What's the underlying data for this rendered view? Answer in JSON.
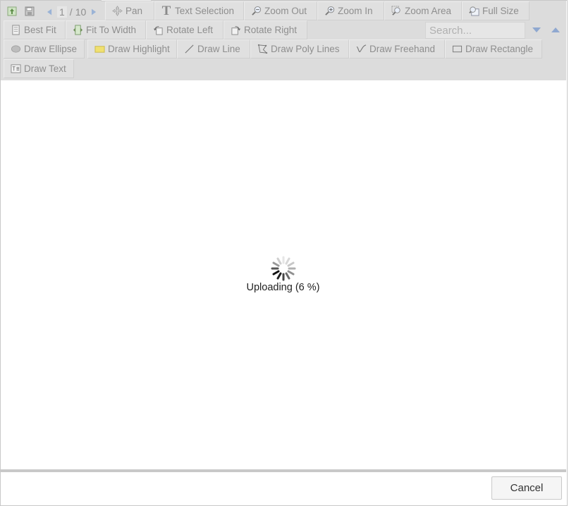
{
  "toolbar": {
    "pager": {
      "current": "1",
      "separator": "/",
      "total": "10"
    },
    "row1": [
      {
        "name": "pan-button",
        "icon": "pan-icon",
        "label": "Pan"
      },
      {
        "name": "text-selection-button",
        "icon": "text-selection-icon",
        "label": "Text Selection"
      },
      {
        "name": "zoom-out-button",
        "icon": "zoom-out-icon",
        "label": "Zoom Out"
      },
      {
        "name": "zoom-in-button",
        "icon": "zoom-in-icon",
        "label": "Zoom In"
      },
      {
        "name": "zoom-area-button",
        "icon": "zoom-area-icon",
        "label": "Zoom Area"
      },
      {
        "name": "full-size-button",
        "icon": "full-size-icon",
        "label": "Full Size"
      }
    ],
    "row2": [
      {
        "name": "best-fit-button",
        "icon": "best-fit-icon",
        "label": "Best Fit"
      },
      {
        "name": "fit-to-width-button",
        "icon": "fit-to-width-icon",
        "label": "Fit To Width"
      },
      {
        "name": "rotate-left-button",
        "icon": "rotate-left-icon",
        "label": "Rotate Left"
      },
      {
        "name": "rotate-right-button",
        "icon": "rotate-right-icon",
        "label": "Rotate Right"
      }
    ],
    "row3": [
      {
        "name": "draw-ellipse-button",
        "icon": "ellipse-icon",
        "label": "Draw Ellipse"
      },
      {
        "name": "draw-highlight-button",
        "icon": "highlight-icon",
        "label": "Draw Highlight"
      },
      {
        "name": "draw-line-button",
        "icon": "line-icon",
        "label": "Draw Line"
      },
      {
        "name": "draw-poly-lines-button",
        "icon": "poly-lines-icon",
        "label": "Draw Poly Lines"
      },
      {
        "name": "draw-freehand-button",
        "icon": "freehand-icon",
        "label": "Draw Freehand"
      },
      {
        "name": "draw-rectangle-button",
        "icon": "rectangle-icon",
        "label": "Draw Rectangle"
      }
    ],
    "row4": [
      {
        "name": "draw-text-button",
        "icon": "draw-text-icon",
        "label": "Draw Text"
      }
    ],
    "search": {
      "placeholder": "Search...",
      "value": ""
    }
  },
  "content": {
    "status": "Uploading (6 %)",
    "progress_percent": 6
  },
  "footer": {
    "cancel_label": "Cancel"
  },
  "colors": {
    "toolbar_bg": "#dcdcdc",
    "button_text": "#8e8e8e",
    "highlight_swatch": "#f0e070",
    "accent_blue": "#5b8fd6"
  }
}
